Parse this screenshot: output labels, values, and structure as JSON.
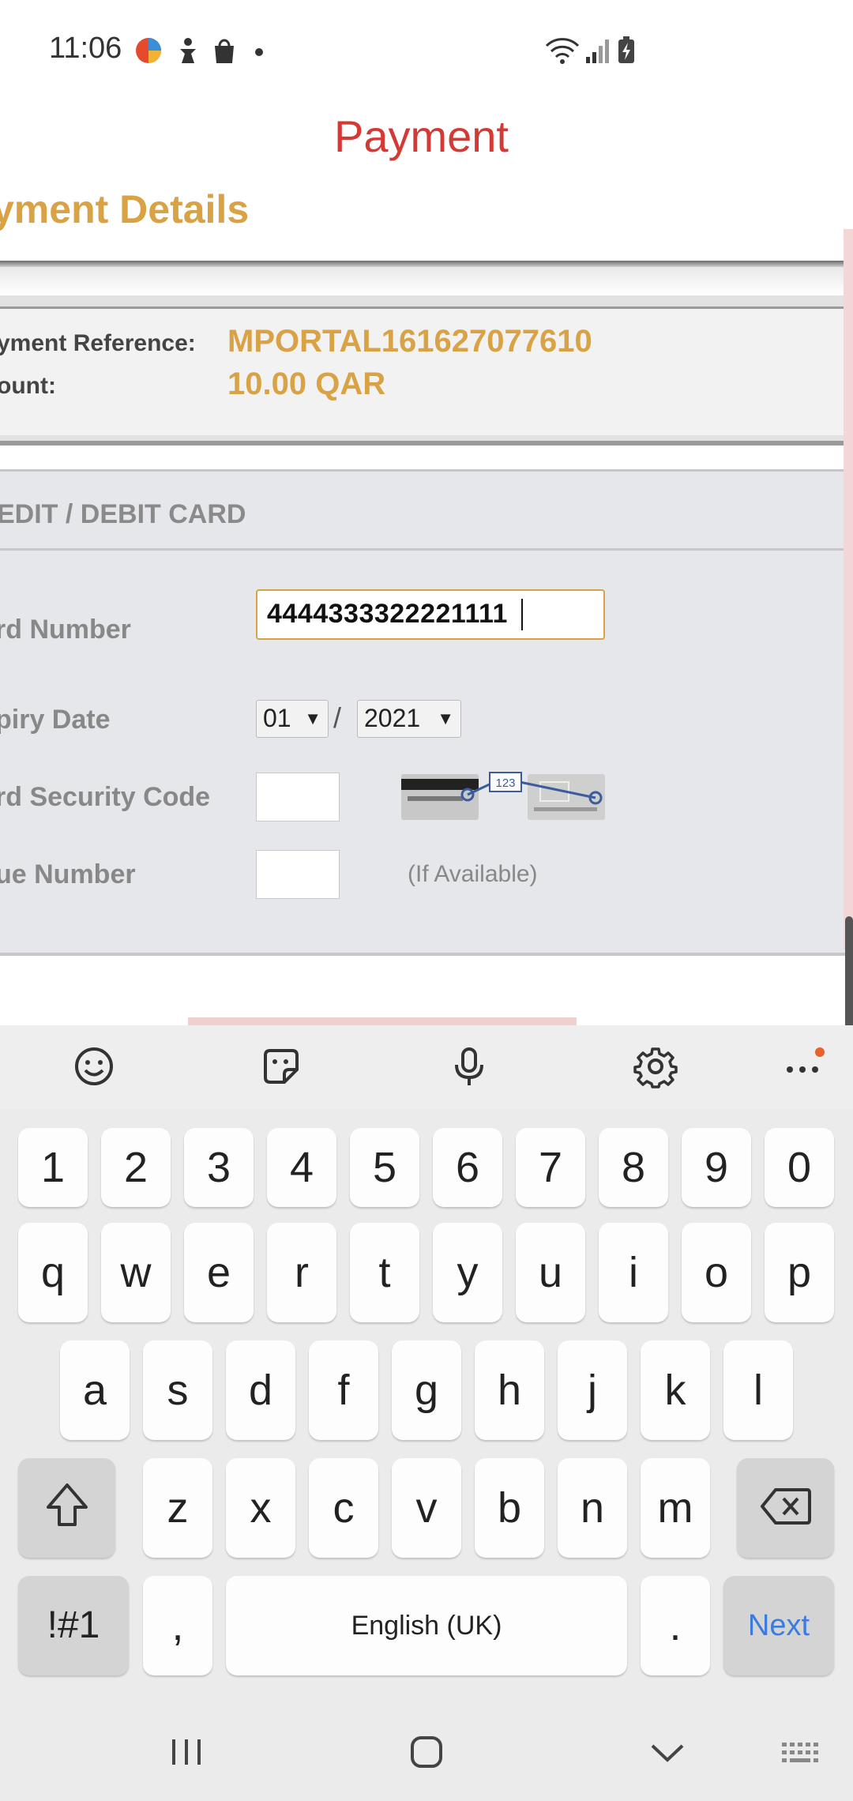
{
  "status_bar": {
    "time": "11:06"
  },
  "header": {
    "title": "Payment"
  },
  "page": {
    "section_heading": "yment Details",
    "summary": {
      "reference_label": "yment Reference:",
      "reference_value": "MPORTAL161627077610",
      "amount_label": "ount:",
      "amount_value": "10.00 QAR"
    },
    "card_section_title": "EDIT / DEBIT CARD",
    "form": {
      "card_number_label": "rd Number",
      "card_number_value": "4444333322221111",
      "expiry_label": "piry Date",
      "expiry_month": "01",
      "expiry_separator": "/",
      "expiry_year": "2021",
      "security_code_label": "rd Security Code",
      "security_hint_number": "123",
      "issue_number_label": "ue Number",
      "issue_hint": "(If Available)"
    }
  },
  "keyboard": {
    "toolbar": [
      "emoji-icon",
      "sticker-icon",
      "microphone-icon",
      "settings-icon",
      "more-icon"
    ],
    "row_numbers": [
      "1",
      "2",
      "3",
      "4",
      "5",
      "6",
      "7",
      "8",
      "9",
      "0"
    ],
    "row_1": [
      "q",
      "w",
      "e",
      "r",
      "t",
      "y",
      "u",
      "i",
      "o",
      "p"
    ],
    "row_2": [
      "a",
      "s",
      "d",
      "f",
      "g",
      "h",
      "j",
      "k",
      "l"
    ],
    "row_3": [
      "z",
      "x",
      "c",
      "v",
      "b",
      "n",
      "m"
    ],
    "symbols_key": "!#1",
    "comma_key": ",",
    "space_key": "English (UK)",
    "period_key": ".",
    "action_key": "Next",
    "action_color": "#3b7be0"
  },
  "colors": {
    "title": "#d43a33",
    "accent": "#d8a245"
  }
}
